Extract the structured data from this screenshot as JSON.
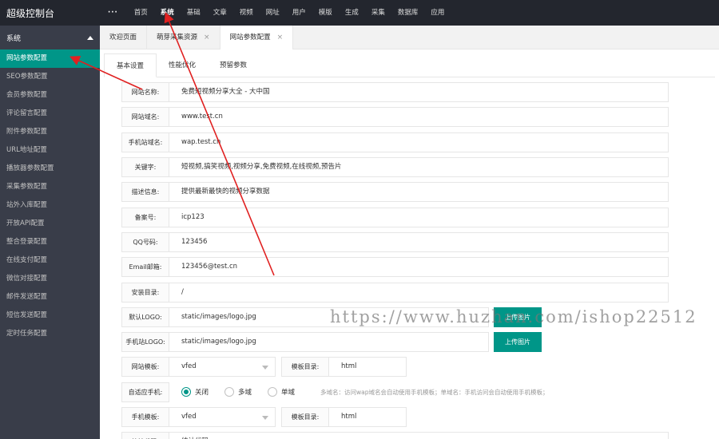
{
  "app": {
    "title": "超级控制台"
  },
  "topnav": {
    "more": "···",
    "items": [
      "首页",
      "系统",
      "基础",
      "文章",
      "视频",
      "网址",
      "用户",
      "模版",
      "生成",
      "采集",
      "数据库",
      "应用"
    ],
    "active": "系统"
  },
  "sidebar": {
    "header": "系统",
    "items": [
      "网站参数配置",
      "SEO参数配置",
      "会员参数配置",
      "评论留言配置",
      "附件参数配置",
      "URL地址配置",
      "播放器参数配置",
      "采集参数配置",
      "站外入库配置",
      "开放API配置",
      "整合登录配置",
      "在线支付配置",
      "微信对接配置",
      "邮件发送配置",
      "短信发送配置",
      "定时任务配置"
    ],
    "active": "网站参数配置"
  },
  "tabs": [
    {
      "label": "欢迎页面"
    },
    {
      "label": "萌芽采集资源",
      "close": "×"
    },
    {
      "label": "网站参数配置",
      "close": "×"
    }
  ],
  "subtabs": [
    "基本设置",
    "性能优化",
    "预留参数"
  ],
  "form": {
    "site_name": {
      "label": "网站名称:",
      "value": "免费短视频分享大全 - 大中国"
    },
    "site_domain": {
      "label": "网站域名:",
      "value": "www.test.cn"
    },
    "mobile_domain": {
      "label": "手机站域名:",
      "value": "wap.test.cn"
    },
    "keywords": {
      "label": "关键字:",
      "value": "短视频,搞笑视频,视频分享,免费视频,在线视频,预告片"
    },
    "description": {
      "label": "描述信息:",
      "value": "提供最新最快的视频分享数据"
    },
    "icp": {
      "label": "备案号:",
      "value": "icp123"
    },
    "qq": {
      "label": "QQ号码:",
      "value": "123456"
    },
    "email": {
      "label": "Email邮箱:",
      "value": "123456@test.cn"
    },
    "install_dir": {
      "label": "安装目录:",
      "value": "/"
    },
    "logo": {
      "label": "默认LOGO:",
      "value": "static/images/logo.jpg",
      "button": "上传图片"
    },
    "mobile_logo": {
      "label": "手机站LOGO:",
      "value": "static/images/logo.jpg",
      "button": "上传图片"
    },
    "template": {
      "label": "网站模板:",
      "value": "vfed",
      "dir_label": "模板目录:",
      "dir_value": "html"
    },
    "adaptive": {
      "label": "自适应手机:",
      "options": [
        "关闭",
        "多域",
        "单域"
      ],
      "selected": "关闭",
      "hint": "多域名：访问wap域名会自动使用手机模板；单域名：手机访问会自动使用手机模板；"
    },
    "mobile_template": {
      "label": "手机模板:",
      "value": "vfed",
      "dir_label": "模板目录:",
      "dir_value": "html"
    },
    "stats": {
      "label": "统计代码:",
      "value": "统计代码"
    }
  },
  "watermark": "https://www.huzhan.com/ishop22512",
  "colors": {
    "accent": "#009688",
    "topbar": "#23262e",
    "sidebar": "#393d49",
    "arrow": "#e02020"
  }
}
